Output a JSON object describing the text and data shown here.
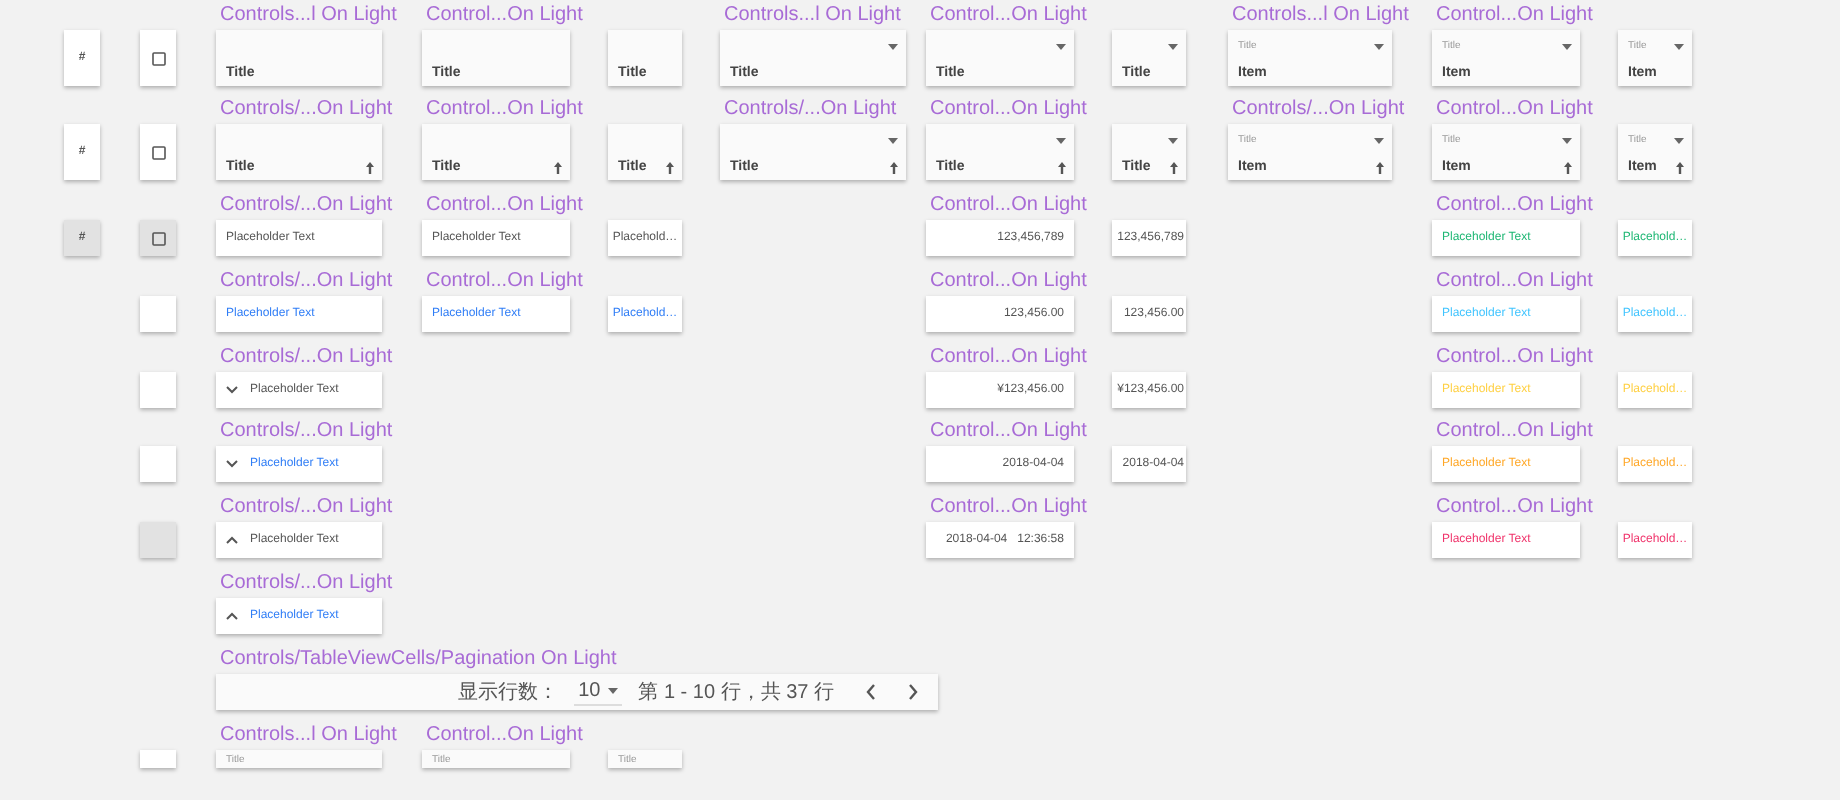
{
  "symbols": [
    {
      "kind": "index-cell",
      "text": "#",
      "pressed": false
    },
    {
      "kind": "checkbox-cell",
      "checked": false,
      "pressed": false
    },
    {
      "kind": "header",
      "label": "Controls...l On Light",
      "title": "Title",
      "sorted": false,
      "filterable": false
    },
    {
      "kind": "header",
      "label": "Control...On Light",
      "title": "Title",
      "sorted": false,
      "filterable": false
    },
    {
      "kind": "header",
      "title": "Title",
      "sorted": false,
      "filterable": false
    },
    {
      "kind": "header",
      "label": "Controls...l On Light",
      "title": "Title",
      "sorted": false,
      "filterable": true
    },
    {
      "kind": "header",
      "label": "Control...On Light",
      "title": "Title",
      "sorted": false,
      "filterable": true
    },
    {
      "kind": "header",
      "title": "Title",
      "sorted": false,
      "filterable": true
    },
    {
      "kind": "header",
      "label": "Controls...l On Light",
      "caption": "Title",
      "title": "Item",
      "sorted": false,
      "filterable": true
    },
    {
      "kind": "header",
      "label": "Control...On Light",
      "caption": "Title",
      "title": "Item",
      "sorted": false,
      "filterable": true
    },
    {
      "kind": "header",
      "caption": "Title",
      "title": "Item",
      "sorted": false,
      "filterable": true
    },
    {
      "kind": "index-cell",
      "text": "#",
      "pressed": false
    },
    {
      "kind": "checkbox-cell",
      "checked": false,
      "pressed": false
    },
    {
      "kind": "header",
      "label": "Controls/...On Light",
      "title": "Title",
      "sorted": true,
      "filterable": false
    },
    {
      "kind": "header",
      "label": "Control...On Light",
      "title": "Title",
      "sorted": true,
      "filterable": false
    },
    {
      "kind": "header",
      "title": "Title",
      "sorted": true,
      "filterable": false
    },
    {
      "kind": "header",
      "label": "Controls/...On Light",
      "title": "Title",
      "sorted": true,
      "filterable": true
    },
    {
      "kind": "header",
      "label": "Control...On Light",
      "title": "Title",
      "sorted": true,
      "filterable": true
    },
    {
      "kind": "header",
      "title": "Title",
      "sorted": true,
      "filterable": true
    },
    {
      "kind": "header",
      "label": "Controls/...On Light",
      "caption": "Title",
      "title": "Item",
      "sorted": true,
      "filterable": true
    },
    {
      "kind": "header",
      "label": "Control...On Light",
      "caption": "Title",
      "title": "Item",
      "sorted": true,
      "filterable": true
    },
    {
      "kind": "header",
      "caption": "Title",
      "title": "Item",
      "sorted": true,
      "filterable": true
    },
    {
      "kind": "index-cell",
      "text": "#",
      "pressed": true
    },
    {
      "kind": "checkbox-cell",
      "checked": false,
      "pressed": true
    },
    {
      "kind": "text-cell",
      "label": "Controls/...On Light",
      "text": "Placeholder Text",
      "color": "#555555"
    },
    {
      "kind": "text-cell",
      "label": "Control...On Light",
      "text": "Placeholder Text",
      "color": "#555555"
    },
    {
      "kind": "text-cell",
      "text": "Placehold…",
      "color": "#555555"
    },
    {
      "kind": "number-cell",
      "label": "Control...On Light",
      "text": "123,456,789",
      "color": "#555555"
    },
    {
      "kind": "number-cell",
      "text": "123,456,789",
      "color": "#555555"
    },
    {
      "kind": "text-cell",
      "label": "Control...On Light",
      "text": "Placeholder Text",
      "color": "#1eb774"
    },
    {
      "kind": "text-cell",
      "text": "Placehold…",
      "color": "#1eb774"
    },
    {
      "kind": "blank-cell",
      "pressed": false
    },
    {
      "kind": "text-cell",
      "label": "Controls/...On Light",
      "text": "Placeholder Text",
      "color": "#2f7df6"
    },
    {
      "kind": "text-cell",
      "label": "Control...On Light",
      "text": "Placeholder Text",
      "color": "#2f7df6"
    },
    {
      "kind": "text-cell",
      "text": "Placehold…",
      "color": "#2f7df6"
    },
    {
      "kind": "number-cell",
      "label": "Control...On Light",
      "text": "123,456.00",
      "color": "#555555"
    },
    {
      "kind": "number-cell",
      "text": "123,456.00",
      "color": "#555555"
    },
    {
      "kind": "text-cell",
      "label": "Control...On Light",
      "text": "Placeholder Text",
      "color": "#40c4ff"
    },
    {
      "kind": "text-cell",
      "text": "Placehold…",
      "color": "#40c4ff"
    },
    {
      "kind": "blank-cell",
      "pressed": false
    },
    {
      "kind": "expander-cell",
      "label": "Controls/...On Light",
      "text": "Placeholder Text",
      "expanded": false,
      "color": "#555555"
    },
    {
      "kind": "number-cell",
      "label": "Control...On Light",
      "text": "¥123,456.00",
      "color": "#555555"
    },
    {
      "kind": "number-cell",
      "text": "¥123,456.00",
      "color": "#555555"
    },
    {
      "kind": "text-cell",
      "label": "Control...On Light",
      "text": "Placeholder Text",
      "color": "#ffd042"
    },
    {
      "kind": "text-cell",
      "text": "Placehold…",
      "color": "#ffd042"
    },
    {
      "kind": "blank-cell",
      "pressed": false
    },
    {
      "kind": "expander-cell",
      "label": "Controls/...On Light",
      "text": "Placeholder Text",
      "expanded": false,
      "color": "#2f7df6"
    },
    {
      "kind": "number-cell",
      "label": "Control...On Light",
      "text": "2018-04-04",
      "color": "#555555"
    },
    {
      "kind": "number-cell",
      "text": "2018-04-04",
      "color": "#555555"
    },
    {
      "kind": "text-cell",
      "label": "Control...On Light",
      "text": "Placeholder Text",
      "color": "#ffa726"
    },
    {
      "kind": "text-cell",
      "text": "Placehold…",
      "color": "#ffa726"
    },
    {
      "kind": "blank-cell",
      "pressed": true
    },
    {
      "kind": "expander-cell",
      "label": "Controls/...On Light",
      "text": "Placeholder Text",
      "expanded": true,
      "color": "#555555"
    },
    {
      "kind": "number-cell",
      "label": "Control...On Light",
      "text": "2018-04-04   12:36:58",
      "color": "#555555"
    },
    {
      "kind": "text-cell",
      "label": "Control...On Light",
      "text": "Placeholder Text",
      "color": "#f0336b"
    },
    {
      "kind": "text-cell",
      "text": "Placehold…",
      "color": "#f0336b"
    },
    {
      "kind": "expander-cell",
      "label": "Controls/...On Light",
      "text": "Placeholder Text",
      "expanded": true,
      "color": "#2f7df6"
    },
    {
      "kind": "pagination",
      "label": "Controls/TableViewCells/Pagination On Light",
      "rows_label": "显示行数：",
      "rows_value": "10",
      "range": "第 1 - 10 行，共 37 行"
    },
    {
      "kind": "blank-cell",
      "pressed": false
    },
    {
      "kind": "compact-header",
      "label": "Controls...l On Light",
      "title": "Title"
    },
    {
      "kind": "compact-header",
      "label": "Control...On Light",
      "title": "Title"
    },
    {
      "kind": "compact-header",
      "title": "Title"
    }
  ]
}
